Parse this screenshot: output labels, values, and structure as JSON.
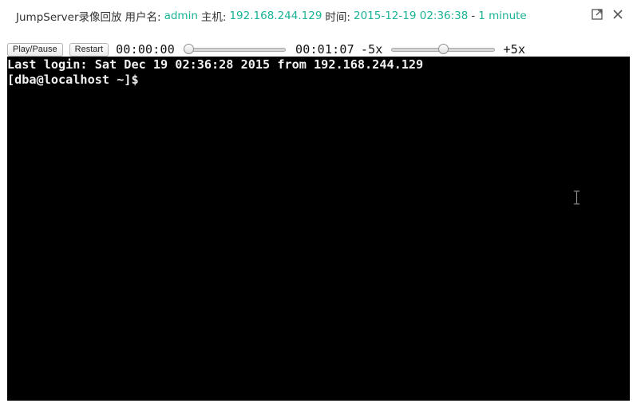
{
  "window": {
    "title_prefix": "JumpServer录像回放",
    "user_label": "用户名:",
    "username": "admin",
    "host_label": "主机:",
    "host": "192.168.244.129",
    "time_label": "时间:",
    "datetime": "2015-12-19 02:36:38",
    "separator": "-",
    "duration": "1 minute",
    "accent_color": "#1ab394",
    "controls": {
      "maximize_icon": "maximize-icon",
      "close_icon": "close-icon"
    }
  },
  "player": {
    "play_pause_label": "Play/Pause",
    "restart_label": "Restart",
    "current_time": "00:00:00",
    "progress_fraction": 0.0,
    "total_time": "00:01:07",
    "speed_min_label": "-5x",
    "speed_max_label": "+5x",
    "speed_fraction": 0.5
  },
  "terminal": {
    "lines": [
      "Last login: Sat Dec 19 02:36:28 2015 from 192.168.244.129",
      "[dba@localhost ~]$"
    ],
    "cursor_icon": "text-cursor-icon"
  }
}
